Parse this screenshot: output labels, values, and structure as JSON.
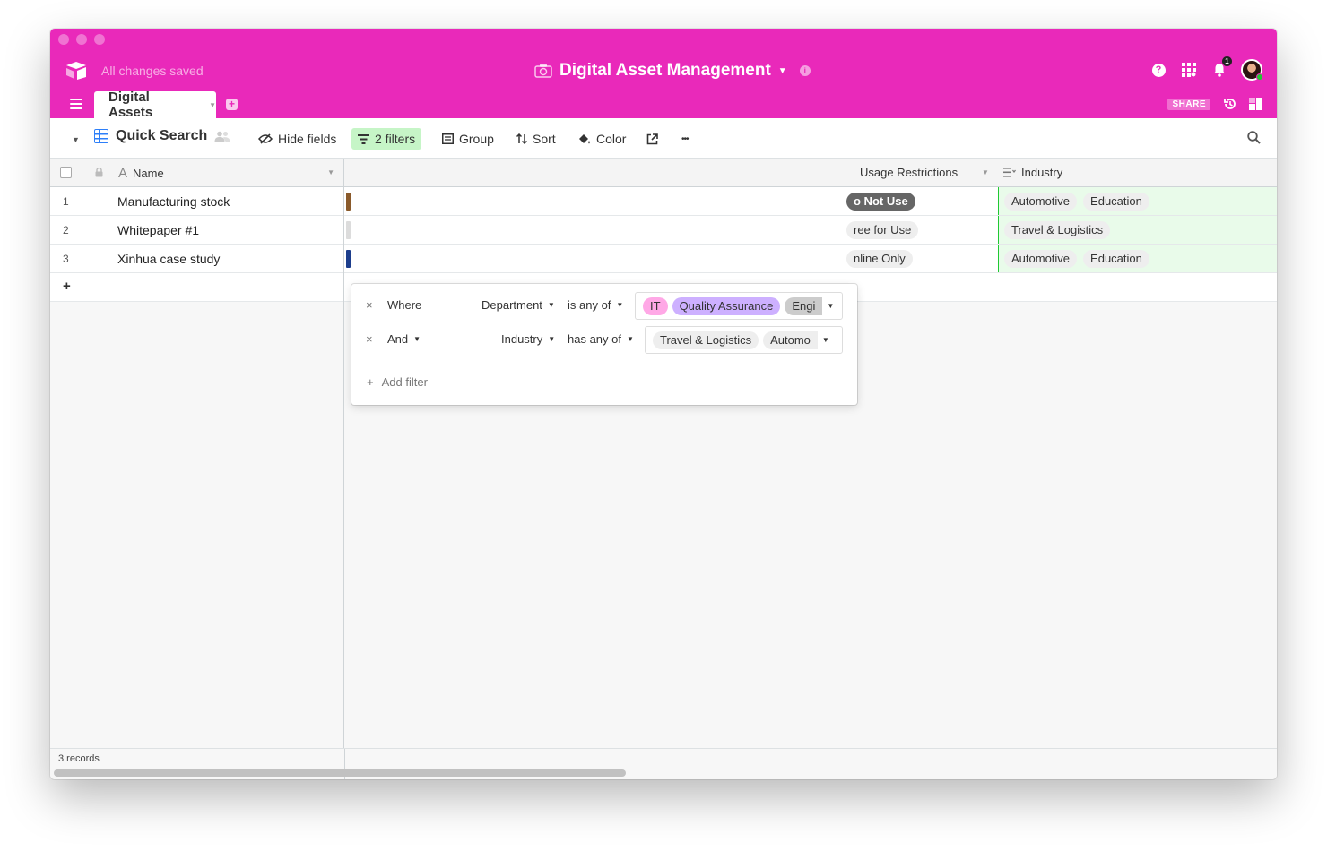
{
  "titlebar": {
    "save_status": "All changes saved",
    "base_name": "Digital Asset Management",
    "notification_count": "1",
    "help_label": "?",
    "share_label": "SHARE"
  },
  "tabs": [
    {
      "label": "Digital Assets"
    }
  ],
  "toolbar": {
    "view_name": "Quick Search",
    "hide_fields": "Hide fields",
    "filters": "2 filters",
    "group": "Group",
    "sort": "Sort",
    "color": "Color",
    "more": "•••"
  },
  "columns": {
    "name": "Name",
    "usage": "Usage Restrictions",
    "industry": "Industry"
  },
  "rows": [
    {
      "num": "1",
      "name": "Manufacturing stock",
      "usage": "o Not Use",
      "industry": [
        "Automotive",
        "Education"
      ]
    },
    {
      "num": "2",
      "name": "Whitepaper #1",
      "usage": "ree for Use",
      "industry": [
        "Travel & Logistics"
      ]
    },
    {
      "num": "3",
      "name": "Xinhua case study",
      "usage": "nline Only",
      "industry": [
        "Automotive",
        "Education"
      ]
    }
  ],
  "add_row_label": "+",
  "footer": {
    "record_count": "3 records"
  },
  "filter_popup": {
    "filters": [
      {
        "remove": "×",
        "conjunction": "Where",
        "field": "Department",
        "operator": "is any of",
        "values": [
          "IT",
          "Quality Assurance",
          "Engi"
        ]
      },
      {
        "remove": "×",
        "conjunction": "And",
        "field": "Industry",
        "operator": "has any of",
        "values": [
          "Travel & Logistics",
          "Automo"
        ]
      }
    ],
    "add_filter": "Add filter",
    "add_filter_icon": "+"
  },
  "colors": {
    "brand": "#e929ba",
    "filter_active": "#c6f5c7",
    "industry_highlight": "#e9fbea",
    "chip_it": "#ffa8e6",
    "chip_qa": "#cdb0ff"
  }
}
